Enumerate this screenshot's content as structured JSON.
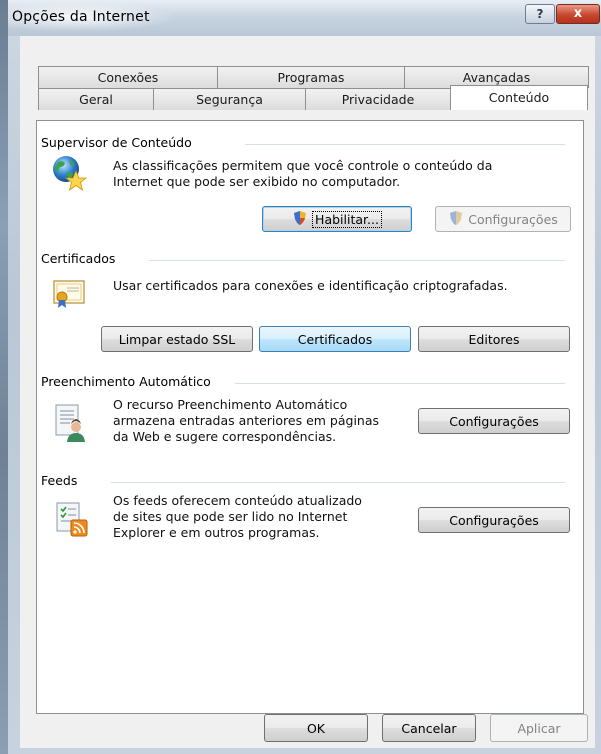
{
  "window": {
    "title": "Opções da Internet",
    "help_glyph": "?",
    "close_glyph": "x"
  },
  "tabs": {
    "row_back": [
      "Conexões",
      "Programas",
      "Avançadas"
    ],
    "row_front": [
      "Geral",
      "Segurança",
      "Privacidade",
      "Conteúdo"
    ],
    "selected": "Conteúdo"
  },
  "supervisor": {
    "title": "Supervisor de Conteúdo",
    "description_line1": "As classificações permitem que você controle o conteúdo da",
    "description_line2": "Internet que pode ser exibido no computador.",
    "enable_button": "Habilitar...",
    "settings_button": "Configurações",
    "icon": "globe-star-icon"
  },
  "certificates": {
    "title": "Certificados",
    "description": "Usar certificados para conexões e identificação criptografadas.",
    "clear_ssl_button": "Limpar estado SSL",
    "certificates_button": "Certificados",
    "publishers_button": "Editores",
    "icon": "certificate-icon"
  },
  "autocomplete": {
    "title": "Preenchimento Automático",
    "description_line1": "O recurso Preenchimento Automático",
    "description_line2": "armazena entradas anteriores em páginas",
    "description_line3": "da Web e sugere correspondências.",
    "settings_button": "Configurações",
    "icon": "autocomplete-form-icon"
  },
  "feeds": {
    "title": "Feeds",
    "description_line1": "Os feeds oferecem conteúdo atualizado",
    "description_line2": "de sites que pode ser lido no Internet",
    "description_line3": "Explorer e em outros programas.",
    "settings_button": "Configurações",
    "icon": "rss-feed-icon"
  },
  "footer": {
    "ok_button": "OK",
    "cancel_button": "Cancelar",
    "apply_button": "Aplicar"
  },
  "colors": {
    "focus_border": "#3c7fb1",
    "close_red": "#c8472f",
    "panel_border": "#8e8f8f"
  }
}
